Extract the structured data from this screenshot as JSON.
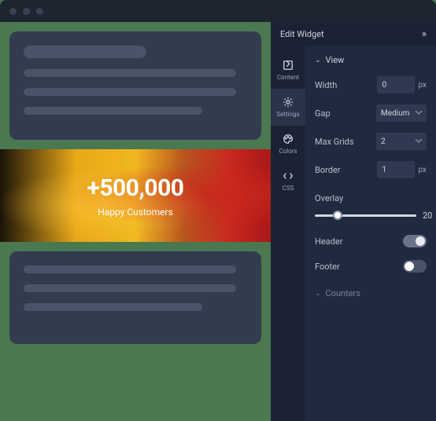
{
  "panel": {
    "title": "Edit Widget",
    "tabs": {
      "content": "Content",
      "settings": "Settings",
      "colors": "Colors",
      "css": "CSS"
    },
    "sections": {
      "view": "View",
      "counters": "Counters"
    },
    "fields": {
      "width": {
        "label": "Width",
        "value": "0",
        "unit": "px"
      },
      "gap": {
        "label": "Gap",
        "value": "Medium"
      },
      "maxGrids": {
        "label": "Max Grids",
        "value": "2"
      },
      "border": {
        "label": "Border",
        "value": "1",
        "unit": "px"
      },
      "overlay": {
        "label": "Overlay",
        "value": "20"
      },
      "header": {
        "label": "Header"
      },
      "footer": {
        "label": "Footer"
      }
    }
  },
  "hero": {
    "counter": "+500,000",
    "subtitle": "Happy Customers"
  }
}
